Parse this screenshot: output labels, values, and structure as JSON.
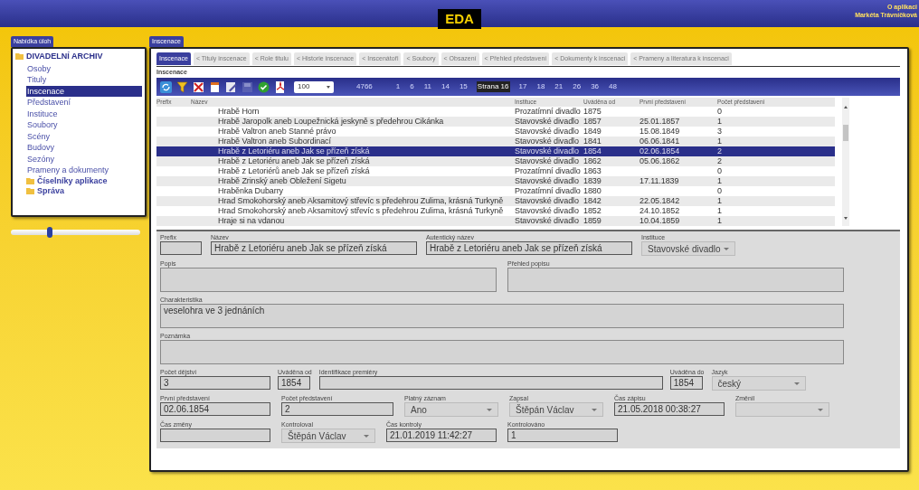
{
  "header": {
    "logo": "EDA",
    "links": [
      "O aplikaci",
      "Markéta Trávníčková"
    ]
  },
  "sidebar": {
    "tab": "Nabídka úloh",
    "root": "DIVADELNÍ ARCHIV",
    "items": [
      {
        "label": "Osoby",
        "selected": false
      },
      {
        "label": "Tituly",
        "selected": false
      },
      {
        "label": "Inscenace",
        "selected": true
      },
      {
        "label": "Představení",
        "selected": false
      },
      {
        "label": "Instituce",
        "selected": false
      },
      {
        "label": "Soubory",
        "selected": false
      },
      {
        "label": "Scény",
        "selected": false
      },
      {
        "label": "Budovy",
        "selected": false
      },
      {
        "label": "Sezóny",
        "selected": false
      },
      {
        "label": "Prameny a dokumenty",
        "selected": false
      }
    ],
    "folders": [
      "Číselníky aplikace",
      "Správa"
    ],
    "slider": {
      "level": 0.3
    }
  },
  "main": {
    "tab": "Inscenace",
    "subtabs": [
      {
        "label": "Inscenace",
        "selected": true
      },
      {
        "label": "< Tituly inscenace",
        "selected": false
      },
      {
        "label": "< Role titulu",
        "selected": false
      },
      {
        "label": "< Historie inscenace",
        "selected": false
      },
      {
        "label": "< Inscenátoři",
        "selected": false
      },
      {
        "label": "< Soubory",
        "selected": false
      },
      {
        "label": "< Obsazení",
        "selected": false
      },
      {
        "label": "< Přehled představení",
        "selected": false
      },
      {
        "label": "< Dokumenty k inscenaci",
        "selected": false
      },
      {
        "label": "< Prameny a literatura k inscenaci",
        "selected": false
      }
    ],
    "section_title": "Inscenace",
    "toolbar": {
      "page_size": "100",
      "count": "4766",
      "pages": [
        {
          "label": "1",
          "selected": false
        },
        {
          "label": "6",
          "selected": false
        },
        {
          "label": "11",
          "selected": false
        },
        {
          "label": "14",
          "selected": false
        },
        {
          "label": "15",
          "selected": false
        },
        {
          "label": "Strana 16",
          "selected": true
        },
        {
          "label": "17",
          "selected": false
        },
        {
          "label": "18",
          "selected": false
        },
        {
          "label": "21",
          "selected": false
        },
        {
          "label": "26",
          "selected": false
        },
        {
          "label": "36",
          "selected": false
        },
        {
          "label": "48",
          "selected": false
        }
      ]
    },
    "table": {
      "columns": [
        "Prefix",
        "Název",
        "Instituce",
        "Uváděna od",
        "První představení",
        "Počet představení"
      ],
      "rows": [
        {
          "name": "Hrabě Horn",
          "institution": "Prozatímní divadlo",
          "from": "1875",
          "count": "0",
          "selected": false
        },
        {
          "name": "Hrabě Jaropolk aneb Loupežnická jeskyně s předehrou Cikánka",
          "institution": "Stavovské divadlo",
          "from": "1857",
          "premiere": "25.01.1857",
          "count": "1",
          "selected": false
        },
        {
          "name": "Hrabě Valtron aneb Stanné právo",
          "institution": "Stavovské divadlo",
          "from": "1849",
          "premiere": "15.08.1849",
          "count": "3",
          "selected": false
        },
        {
          "name": "Hrabě Valtron aneb Subordinací",
          "institution": "Stavovské divadlo",
          "from": "1841",
          "premiere": "06.06.1841",
          "count": "1",
          "selected": false
        },
        {
          "name": "Hrabě z Letoriéru aneb Jak se přízeň získá",
          "institution": "Stavovské divadlo",
          "from": "1854",
          "premiere": "02.06.1854",
          "count": "2",
          "selected": true
        },
        {
          "name": "Hrabě z Letoriéru aneb Jak se přízeň získá",
          "institution": "Stavovské divadlo",
          "from": "1862",
          "premiere": "05.06.1862",
          "count": "2",
          "selected": false
        },
        {
          "name": "Hrabě z Letoriérů aneb Jak se přízeň získá",
          "institution": "Prozatímní divadlo",
          "from": "1863",
          "count": "0",
          "selected": false
        },
        {
          "name": "Hrabě Zrinský aneb Obležení Sigetu",
          "institution": "Stavovské divadlo",
          "from": "1839",
          "premiere": "17.11.1839",
          "count": "1",
          "selected": false
        },
        {
          "name": "Hraběnka Dubarry",
          "institution": "Prozatímní divadlo",
          "from": "1880",
          "count": "0",
          "selected": false
        },
        {
          "name": "Hrad Smokohorský aneb Aksamitový střevíc s předehrou Zulima, krásná Turkyně",
          "institution": "Stavovské divadlo",
          "from": "1842",
          "premiere": "22.05.1842",
          "count": "1",
          "selected": false
        },
        {
          "name": "Hrad Smokohorský aneb Aksamitový střevíc s předehrou Zulima, krásná Turkyně",
          "institution": "Stavovské divadlo",
          "from": "1852",
          "premiere": "24.10.1852",
          "count": "1",
          "selected": false
        },
        {
          "name": "Hraje si na vdanou",
          "institution": "Stavovské divadlo",
          "from": "1859",
          "premiere": "10.04.1859",
          "count": "1",
          "selected": false
        }
      ]
    },
    "form": {
      "lines": [
        {
          "fields": [
            {
              "kind": "text",
              "label": "Prefix"
            },
            {
              "kind": "text",
              "label": "Název",
              "value": "Hrabě z Letoriéru aneb Jak se přízeň získá"
            },
            {
              "kind": "text",
              "label": "Autentický název",
              "value": "Hrabě z Letoriéru aneb Jak se přízeň získá"
            },
            {
              "kind": "select",
              "label": "Instituce",
              "value": "Stavovské divadlo"
            }
          ]
        },
        {
          "fields": [
            {
              "kind": "textarea",
              "label": "Popis"
            },
            {
              "kind": "textarea",
              "label": "Přehled popisu"
            }
          ]
        },
        {
          "fields": [
            {
              "kind": "textarea",
              "label": "Charakteristika",
              "value": "veselohra ve 3 jednáních"
            }
          ]
        },
        {
          "fields": [
            {
              "kind": "textarea",
              "label": "Poznámka"
            }
          ]
        },
        {
          "fields": [
            {
              "kind": "text",
              "label": "Počet dějství",
              "value": "3"
            },
            {
              "kind": "text",
              "label": "Uváděna od",
              "value": "1854"
            },
            {
              "kind": "text",
              "label": "Identifikace premiéry"
            },
            {
              "kind": "text",
              "label": "Uváděna do",
              "value": "1854"
            },
            {
              "kind": "select",
              "label": "Jazyk",
              "value": "český"
            }
          ]
        },
        {
          "fields": [
            {
              "kind": "text",
              "label": "První představení",
              "value": "02.06.1854"
            },
            {
              "kind": "text",
              "label": "Počet představení",
              "value": "2"
            },
            {
              "kind": "select",
              "label": "Platný záznam",
              "value": "Ano"
            },
            {
              "kind": "select",
              "label": "Zapsal",
              "value": "Štěpán Václav"
            },
            {
              "kind": "text",
              "label": "Čas zápisu",
              "value": "21.05.2018 00:38:27"
            },
            {
              "kind": "select",
              "label": "Změnil"
            }
          ]
        },
        {
          "fields": [
            {
              "kind": "text",
              "label": "Čas změny"
            },
            {
              "kind": "select",
              "label": "Kontroloval",
              "value": "Štěpán Václav"
            },
            {
              "kind": "text",
              "label": "Čas kontroly",
              "value": "21.01.2019 11:42:27"
            },
            {
              "kind": "text",
              "label": "Kontrolováno",
              "value": "1"
            }
          ]
        }
      ]
    }
  }
}
